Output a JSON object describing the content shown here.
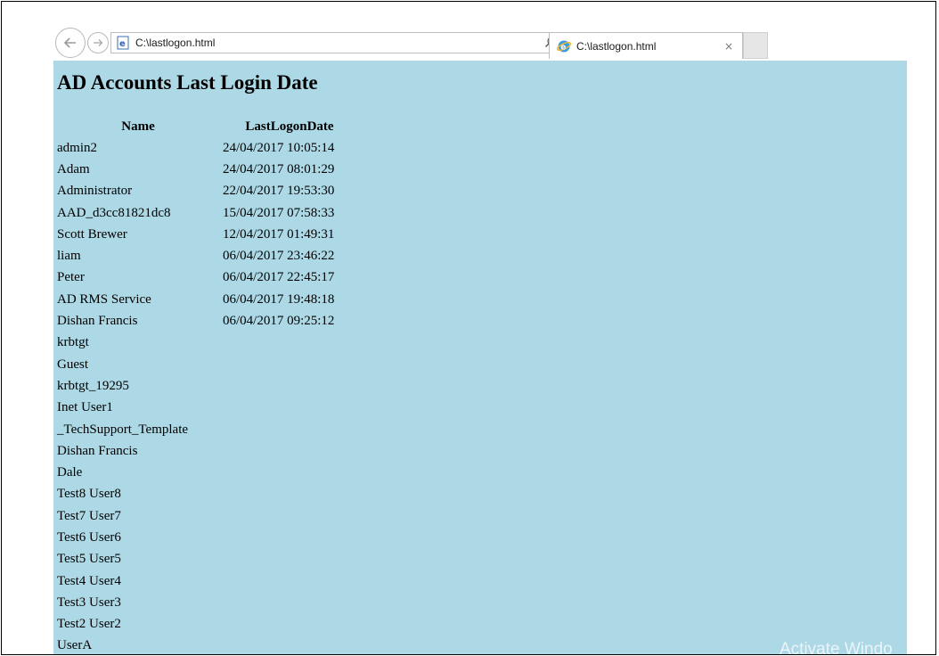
{
  "browser": {
    "address": "C:\\lastlogon.html",
    "tab_title": "C:\\lastlogon.html",
    "search_icon": "search-icon",
    "refresh_icon": "refresh-icon",
    "tab_close": "×",
    "page_bg": "#add8e6"
  },
  "page": {
    "title": "AD Accounts Last Login Date",
    "columns": [
      "Name",
      "LastLogonDate"
    ],
    "rows": [
      [
        "admin2",
        "24/04/2017 10:05:14"
      ],
      [
        "Adam",
        "24/04/2017 08:01:29"
      ],
      [
        "Administrator",
        "22/04/2017 19:53:30"
      ],
      [
        "AAD_d3cc81821dc8",
        "15/04/2017 07:58:33"
      ],
      [
        "Scott Brewer",
        "12/04/2017 01:49:31"
      ],
      [
        "liam",
        "06/04/2017 23:46:22"
      ],
      [
        "Peter",
        "06/04/2017 22:45:17"
      ],
      [
        "AD RMS Service",
        "06/04/2017 19:48:18"
      ],
      [
        "Dishan Francis",
        "06/04/2017 09:25:12"
      ],
      [
        "krbtgt",
        ""
      ],
      [
        "Guest",
        ""
      ],
      [
        "krbtgt_19295",
        ""
      ],
      [
        "Inet User1",
        ""
      ],
      [
        "_TechSupport_Template",
        ""
      ],
      [
        "Dishan Francis",
        ""
      ],
      [
        "Dale",
        ""
      ],
      [
        "Test8 User8",
        ""
      ],
      [
        "Test7 User7",
        ""
      ],
      [
        "Test6 User6",
        ""
      ],
      [
        "Test5 User5",
        ""
      ],
      [
        "Test4 User4",
        ""
      ],
      [
        "Test3 User3",
        ""
      ],
      [
        "Test2 User2",
        ""
      ],
      [
        "UserA",
        ""
      ]
    ]
  },
  "watermark": "Activate Windo"
}
